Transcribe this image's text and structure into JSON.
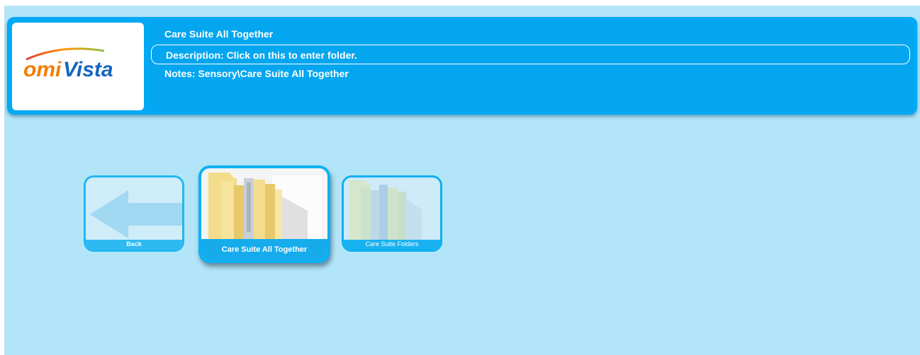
{
  "header": {
    "logo_text": "omiVista",
    "title": "Care Suite All Together",
    "description": "Description: Click on this to enter folder.",
    "notes": "Notes: Sensory\\Care Suite All Together"
  },
  "tiles": [
    {
      "label": "Back",
      "icon": "back-arrow-icon",
      "selected": false
    },
    {
      "label": "Care Suite All Together",
      "icon": "folder-icon",
      "selected": true
    },
    {
      "label": "Care Suite Folders",
      "icon": "folder-icon",
      "selected": false
    }
  ],
  "colors": {
    "background": "#b3e5f9",
    "header": "#03a9f4",
    "tile_border": "#0bb0f3",
    "text": "#ffffff"
  }
}
